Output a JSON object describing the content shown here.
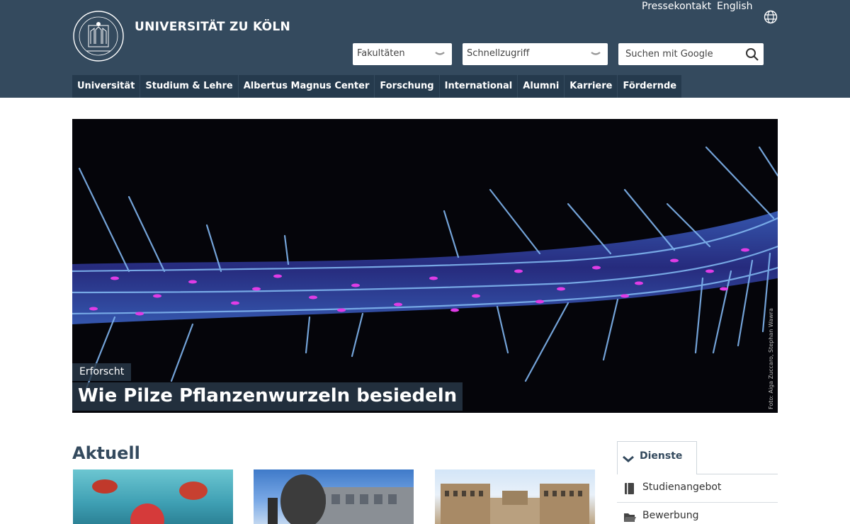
{
  "header": {
    "brand": "UNIVERSITÄT ZU KÖLN",
    "top_links": [
      "Pressekontakt",
      "English"
    ],
    "faculties_select": "Fakultäten",
    "quick_access_select": "Schnellzugriff",
    "search_placeholder": "Suchen mit Google",
    "nav": [
      "Universität",
      "Studium & Lehre",
      "Albertus Magnus Center",
      "Forschung",
      "International",
      "Alumni",
      "Karriere",
      "Fördernde"
    ],
    "colors": {
      "header_bg": "#344a5e",
      "nav_bg": "#253a4d"
    }
  },
  "hero": {
    "tag": "Erforscht",
    "title": "Wie Pilze Pflanzenwurzeln besiedeln",
    "credit": "Foto: Aiga Zuccaro, Stephan Wawra"
  },
  "news": {
    "title": "Aktuell"
  },
  "sidebar": {
    "tab_label": "Dienste",
    "items": [
      {
        "label": "Studienangebot",
        "icon": "book-icon"
      },
      {
        "label": "Bewerbung",
        "icon": "folder-icon"
      }
    ]
  }
}
